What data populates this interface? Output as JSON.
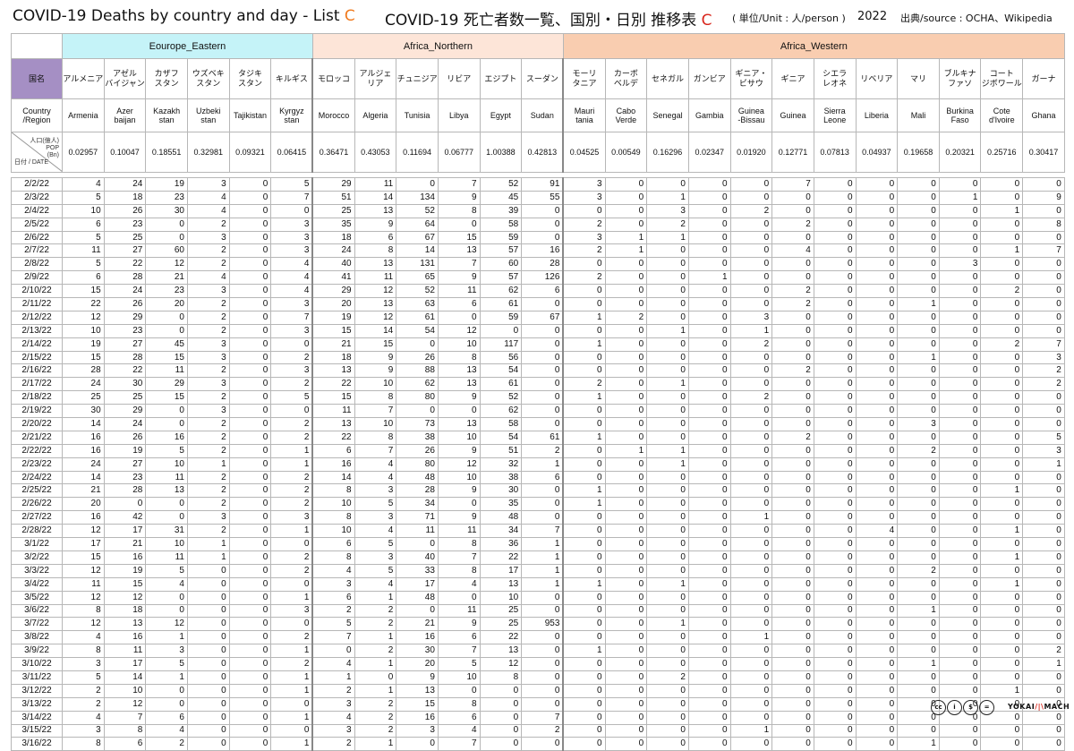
{
  "title": {
    "en_prefix": "COVID-19 Deaths by country and day - List",
    "en_letter": "C",
    "jp_prefix": "COVID-19 死亡者数一覧、国別・日別 推移表",
    "jp_letter": "C",
    "unit": "( 単位/Unit : 人/person )",
    "year": "2022",
    "source": "出典/source : OCHA、Wikipedia"
  },
  "header": {
    "corner_jp": "国名",
    "corner_en": "Country\n/Region",
    "corner_pop": "人口(億人)\nPOP\n(Bn)",
    "corner_date": "日付 / DATE",
    "groups": [
      {
        "label": "Eourope_Eastern",
        "span": 6,
        "cls": "h-eastern"
      },
      {
        "label": "Africa_Northern",
        "span": 6,
        "cls": "h-northern"
      },
      {
        "label": "Africa_Western",
        "span": 12,
        "cls": "h-western"
      }
    ]
  },
  "countries": [
    {
      "jp": "アルメニア",
      "en": "Armenia",
      "pop": "0.02957"
    },
    {
      "jp": "アゼル\nバイジャン",
      "en": "Azer\nbaijan",
      "pop": "0.10047"
    },
    {
      "jp": "カザフ\nスタン",
      "en": "Kazakh\nstan",
      "pop": "0.18551"
    },
    {
      "jp": "ウズベキ\nスタン",
      "en": "Uzbeki\nstan",
      "pop": "0.32981"
    },
    {
      "jp": "タジキ\nスタン",
      "en": "Tajikistan",
      "pop": "0.09321"
    },
    {
      "jp": "キルギス",
      "en": "Kyrgyz\nstan",
      "pop": "0.06415"
    },
    {
      "jp": "モロッコ",
      "en": "Morocco",
      "pop": "0.36471"
    },
    {
      "jp": "アルジェ\nリア",
      "en": "Algeria",
      "pop": "0.43053"
    },
    {
      "jp": "チュニジア",
      "en": "Tunisia",
      "pop": "0.11694"
    },
    {
      "jp": "リビア",
      "en": "Libya",
      "pop": "0.06777"
    },
    {
      "jp": "エジプト",
      "en": "Egypt",
      "pop": "1.00388"
    },
    {
      "jp": "スーダン",
      "en": "Sudan",
      "pop": "0.42813"
    },
    {
      "jp": "モーリ\nタニア",
      "en": "Mauri\ntania",
      "pop": "0.04525"
    },
    {
      "jp": "カーボ\nベルデ",
      "en": "Cabo\nVerde",
      "pop": "0.00549"
    },
    {
      "jp": "セネガル",
      "en": "Senegal",
      "pop": "0.16296"
    },
    {
      "jp": "ガンビア",
      "en": "Gambia",
      "pop": "0.02347"
    },
    {
      "jp": "ギニア・\nビサウ",
      "en": "Guinea\n-Bissau",
      "pop": "0.01920"
    },
    {
      "jp": "ギニア",
      "en": "Guinea",
      "pop": "0.12771"
    },
    {
      "jp": "シエラ\nレオネ",
      "en": "Sierra\nLeone",
      "pop": "0.07813"
    },
    {
      "jp": "リベリア",
      "en": "Liberia",
      "pop": "0.04937"
    },
    {
      "jp": "マリ",
      "en": "Mali",
      "pop": "0.19658"
    },
    {
      "jp": "ブルキナ\nファソ",
      "en": "Burkina\nFaso",
      "pop": "0.20321"
    },
    {
      "jp": "コート\nジボワール",
      "en": "Cote\nd'Ivoire",
      "pop": "0.25716"
    },
    {
      "jp": "ガーナ",
      "en": "Ghana",
      "pop": "0.30417"
    }
  ],
  "rows": [
    {
      "date": "2/2/22",
      "v": [
        4,
        24,
        19,
        3,
        0,
        5,
        29,
        11,
        0,
        7,
        52,
        91,
        3,
        0,
        0,
        0,
        0,
        7,
        0,
        0,
        0,
        0,
        0,
        0
      ]
    },
    {
      "date": "2/3/22",
      "v": [
        5,
        18,
        23,
        4,
        0,
        7,
        51,
        14,
        134,
        9,
        45,
        55,
        3,
        0,
        1,
        0,
        0,
        0,
        0,
        0,
        0,
        1,
        0,
        9
      ]
    },
    {
      "date": "2/4/22",
      "v": [
        10,
        26,
        30,
        4,
        0,
        0,
        25,
        13,
        52,
        8,
        39,
        0,
        0,
        0,
        3,
        0,
        2,
        0,
        0,
        0,
        0,
        0,
        1,
        0
      ]
    },
    {
      "date": "2/5/22",
      "v": [
        6,
        23,
        0,
        2,
        0,
        3,
        35,
        9,
        64,
        0,
        58,
        0,
        2,
        0,
        2,
        0,
        0,
        2,
        0,
        0,
        0,
        0,
        0,
        8
      ]
    },
    {
      "date": "2/6/22",
      "v": [
        5,
        25,
        0,
        3,
        0,
        3,
        18,
        6,
        67,
        15,
        59,
        0,
        3,
        1,
        1,
        0,
        0,
        0,
        0,
        0,
        0,
        0,
        0,
        0
      ]
    },
    {
      "date": "2/7/22",
      "v": [
        11,
        27,
        60,
        2,
        0,
        3,
        24,
        8,
        14,
        13,
        57,
        16,
        2,
        1,
        0,
        0,
        0,
        4,
        0,
        0,
        0,
        0,
        1,
        7
      ]
    },
    {
      "date": "2/8/22",
      "v": [
        5,
        22,
        12,
        2,
        0,
        4,
        40,
        13,
        131,
        7,
        60,
        28,
        0,
        0,
        0,
        0,
        0,
        0,
        0,
        0,
        0,
        3,
        0,
        0
      ]
    },
    {
      "date": "2/9/22",
      "v": [
        6,
        28,
        21,
        4,
        0,
        4,
        41,
        11,
        65,
        9,
        57,
        126,
        2,
        0,
        0,
        1,
        0,
        0,
        0,
        0,
        0,
        0,
        0,
        0
      ]
    },
    {
      "date": "2/10/22",
      "v": [
        15,
        24,
        23,
        3,
        0,
        4,
        29,
        12,
        52,
        11,
        62,
        6,
        0,
        0,
        0,
        0,
        0,
        2,
        0,
        0,
        0,
        0,
        2,
        0
      ]
    },
    {
      "date": "2/11/22",
      "v": [
        22,
        26,
        20,
        2,
        0,
        3,
        20,
        13,
        63,
        6,
        61,
        0,
        0,
        0,
        0,
        0,
        0,
        2,
        0,
        0,
        1,
        0,
        0,
        0
      ]
    },
    {
      "date": "2/12/22",
      "v": [
        12,
        29,
        0,
        2,
        0,
        7,
        19,
        12,
        61,
        0,
        59,
        67,
        1,
        2,
        0,
        0,
        3,
        0,
        0,
        0,
        0,
        0,
        0,
        0
      ]
    },
    {
      "date": "2/13/22",
      "v": [
        10,
        23,
        0,
        2,
        0,
        3,
        15,
        14,
        54,
        12,
        0,
        0,
        0,
        0,
        1,
        0,
        1,
        0,
        0,
        0,
        0,
        0,
        0,
        0
      ]
    },
    {
      "date": "2/14/22",
      "v": [
        19,
        27,
        45,
        3,
        0,
        0,
        21,
        15,
        0,
        10,
        117,
        0,
        1,
        0,
        0,
        0,
        2,
        0,
        0,
        0,
        0,
        0,
        2,
        7
      ]
    },
    {
      "date": "2/15/22",
      "v": [
        15,
        28,
        15,
        3,
        0,
        2,
        18,
        9,
        26,
        8,
        56,
        0,
        0,
        0,
        0,
        0,
        0,
        0,
        0,
        0,
        1,
        0,
        0,
        3
      ]
    },
    {
      "date": "2/16/22",
      "v": [
        28,
        22,
        11,
        2,
        0,
        3,
        13,
        9,
        88,
        13,
        54,
        0,
        0,
        0,
        0,
        0,
        0,
        2,
        0,
        0,
        0,
        0,
        0,
        2
      ]
    },
    {
      "date": "2/17/22",
      "v": [
        24,
        30,
        29,
        3,
        0,
        2,
        22,
        10,
        62,
        13,
        61,
        0,
        2,
        0,
        1,
        0,
        0,
        0,
        0,
        0,
        0,
        0,
        0,
        2
      ]
    },
    {
      "date": "2/18/22",
      "v": [
        25,
        25,
        15,
        2,
        0,
        5,
        15,
        8,
        80,
        9,
        52,
        0,
        1,
        0,
        0,
        0,
        2,
        0,
        0,
        0,
        0,
        0,
        0,
        0
      ]
    },
    {
      "date": "2/19/22",
      "v": [
        30,
        29,
        0,
        3,
        0,
        0,
        11,
        7,
        0,
        0,
        62,
        0,
        0,
        0,
        0,
        0,
        0,
        0,
        0,
        0,
        0,
        0,
        0,
        0
      ]
    },
    {
      "date": "2/20/22",
      "v": [
        14,
        24,
        0,
        2,
        0,
        2,
        13,
        10,
        73,
        13,
        58,
        0,
        0,
        0,
        0,
        0,
        0,
        0,
        0,
        0,
        3,
        0,
        0,
        0
      ]
    },
    {
      "date": "2/21/22",
      "v": [
        16,
        26,
        16,
        2,
        0,
        2,
        22,
        8,
        38,
        10,
        54,
        61,
        1,
        0,
        0,
        0,
        0,
        2,
        0,
        0,
        0,
        0,
        0,
        5
      ]
    },
    {
      "date": "2/22/22",
      "v": [
        16,
        19,
        5,
        2,
        0,
        1,
        6,
        7,
        26,
        9,
        51,
        2,
        0,
        1,
        1,
        0,
        0,
        0,
        0,
        0,
        2,
        0,
        0,
        3
      ]
    },
    {
      "date": "2/23/22",
      "v": [
        24,
        27,
        10,
        1,
        0,
        1,
        16,
        4,
        80,
        12,
        32,
        1,
        0,
        0,
        1,
        0,
        0,
        0,
        0,
        0,
        0,
        0,
        0,
        1
      ]
    },
    {
      "date": "2/24/22",
      "v": [
        14,
        23,
        11,
        2,
        0,
        2,
        14,
        4,
        48,
        10,
        38,
        6,
        0,
        0,
        0,
        0,
        0,
        0,
        0,
        0,
        0,
        0,
        0,
        0
      ]
    },
    {
      "date": "2/25/22",
      "v": [
        21,
        28,
        13,
        2,
        0,
        2,
        8,
        3,
        28,
        9,
        30,
        0,
        1,
        0,
        0,
        0,
        0,
        0,
        0,
        0,
        0,
        0,
        1,
        0
      ]
    },
    {
      "date": "2/26/22",
      "v": [
        20,
        0,
        0,
        2,
        0,
        2,
        10,
        5,
        34,
        0,
        35,
        0,
        1,
        0,
        0,
        0,
        0,
        0,
        0,
        0,
        0,
        0,
        0,
        0
      ]
    },
    {
      "date": "2/27/22",
      "v": [
        16,
        42,
        0,
        3,
        0,
        3,
        8,
        3,
        71,
        9,
        48,
        0,
        0,
        0,
        0,
        0,
        1,
        0,
        0,
        0,
        0,
        0,
        0,
        0
      ]
    },
    {
      "date": "2/28/22",
      "v": [
        12,
        17,
        31,
        2,
        0,
        1,
        10,
        4,
        11,
        11,
        34,
        7,
        0,
        0,
        0,
        0,
        0,
        0,
        0,
        4,
        0,
        0,
        1,
        0
      ]
    },
    {
      "date": "3/1/22",
      "v": [
        17,
        21,
        10,
        1,
        0,
        0,
        6,
        5,
        0,
        8,
        36,
        1,
        0,
        0,
        0,
        0,
        0,
        0,
        0,
        0,
        0,
        0,
        0,
        0
      ]
    },
    {
      "date": "3/2/22",
      "v": [
        15,
        16,
        11,
        1,
        0,
        2,
        8,
        3,
        40,
        7,
        22,
        1,
        0,
        0,
        0,
        0,
        0,
        0,
        0,
        0,
        0,
        0,
        1,
        0
      ]
    },
    {
      "date": "3/3/22",
      "v": [
        12,
        19,
        5,
        0,
        0,
        2,
        4,
        5,
        33,
        8,
        17,
        1,
        0,
        0,
        0,
        0,
        0,
        0,
        0,
        0,
        2,
        0,
        0,
        0
      ]
    },
    {
      "date": "3/4/22",
      "v": [
        11,
        15,
        4,
        0,
        0,
        0,
        3,
        4,
        17,
        4,
        13,
        1,
        1,
        0,
        1,
        0,
        0,
        0,
        0,
        0,
        0,
        0,
        1,
        0
      ]
    },
    {
      "date": "3/5/22",
      "v": [
        12,
        12,
        0,
        0,
        0,
        1,
        6,
        1,
        48,
        0,
        10,
        0,
        0,
        0,
        0,
        0,
        0,
        0,
        0,
        0,
        0,
        0,
        0,
        0
      ]
    },
    {
      "date": "3/6/22",
      "v": [
        8,
        18,
        0,
        0,
        0,
        3,
        2,
        2,
        0,
        11,
        25,
        0,
        0,
        0,
        0,
        0,
        0,
        0,
        0,
        0,
        1,
        0,
        0,
        0
      ]
    },
    {
      "date": "3/7/22",
      "v": [
        12,
        13,
        12,
        0,
        0,
        0,
        5,
        2,
        21,
        9,
        25,
        953,
        0,
        0,
        1,
        0,
        0,
        0,
        0,
        0,
        0,
        0,
        0,
        0
      ]
    },
    {
      "date": "3/8/22",
      "v": [
        4,
        16,
        1,
        0,
        0,
        2,
        7,
        1,
        16,
        6,
        22,
        0,
        0,
        0,
        0,
        0,
        1,
        0,
        0,
        0,
        0,
        0,
        0,
        0
      ]
    },
    {
      "date": "3/9/22",
      "v": [
        8,
        11,
        3,
        0,
        0,
        1,
        0,
        2,
        30,
        7,
        13,
        0,
        1,
        0,
        0,
        0,
        0,
        0,
        0,
        0,
        0,
        0,
        0,
        2
      ]
    },
    {
      "date": "3/10/22",
      "v": [
        3,
        17,
        5,
        0,
        0,
        2,
        4,
        1,
        20,
        5,
        12,
        0,
        0,
        0,
        0,
        0,
        0,
        0,
        0,
        0,
        1,
        0,
        0,
        1
      ]
    },
    {
      "date": "3/11/22",
      "v": [
        5,
        14,
        1,
        0,
        0,
        1,
        1,
        0,
        9,
        10,
        8,
        0,
        0,
        0,
        2,
        0,
        0,
        0,
        0,
        0,
        0,
        0,
        0,
        0
      ]
    },
    {
      "date": "3/12/22",
      "v": [
        2,
        10,
        0,
        0,
        0,
        1,
        2,
        1,
        13,
        0,
        0,
        0,
        0,
        0,
        0,
        0,
        0,
        0,
        0,
        0,
        0,
        0,
        1,
        0
      ]
    },
    {
      "date": "3/13/22",
      "v": [
        2,
        12,
        0,
        0,
        0,
        0,
        3,
        2,
        15,
        8,
        0,
        0,
        0,
        0,
        0,
        0,
        0,
        0,
        0,
        0,
        0,
        0,
        0,
        0
      ]
    },
    {
      "date": "3/14/22",
      "v": [
        4,
        7,
        6,
        0,
        0,
        1,
        4,
        2,
        16,
        6,
        0,
        7,
        0,
        0,
        0,
        0,
        0,
        0,
        0,
        0,
        0,
        0,
        0,
        0
      ]
    },
    {
      "date": "3/15/22",
      "v": [
        3,
        8,
        4,
        0,
        0,
        0,
        3,
        2,
        3,
        4,
        0,
        2,
        0,
        0,
        0,
        0,
        1,
        0,
        0,
        0,
        0,
        0,
        0,
        0
      ]
    },
    {
      "date": "3/16/22",
      "v": [
        8,
        6,
        2,
        0,
        0,
        1,
        2,
        1,
        0,
        7,
        0,
        0,
        0,
        0,
        0,
        0,
        0,
        0,
        0,
        0,
        1,
        0,
        0,
        0
      ]
    }
  ],
  "footer": {
    "license_icons": [
      "cc-icon",
      "by-icon",
      "nc-icon",
      "nd-icon"
    ],
    "license_glyphs": [
      "cc",
      "i",
      "$",
      "="
    ],
    "brand_left": "YOKAI",
    "brand_mark": "/|\\",
    "brand_right": "MACH"
  }
}
